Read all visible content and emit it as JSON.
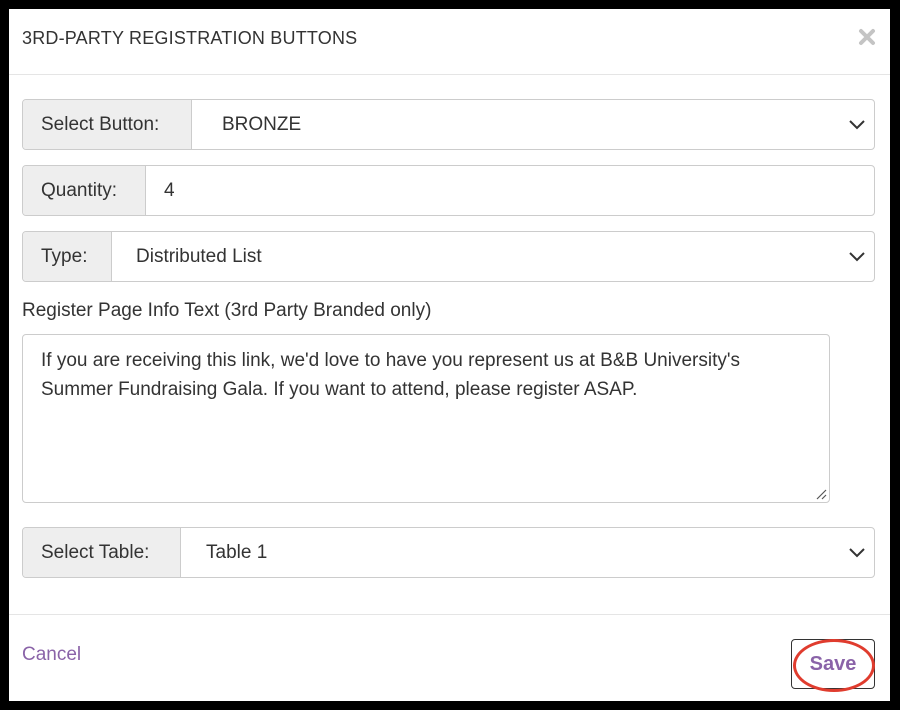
{
  "modal": {
    "title": "3RD-PARTY REGISTRATION BUTTONS",
    "close_icon": "close-icon"
  },
  "fields": {
    "select_button": {
      "label": "Select Button:",
      "value": "BRONZE"
    },
    "quantity": {
      "label": "Quantity:",
      "value": "4"
    },
    "type": {
      "label": "Type:",
      "value": "Distributed List"
    },
    "info_text": {
      "label": "Register Page Info Text (3rd Party Branded only)",
      "value": "If you are receiving this link, we'd love to have you represent us at B&B University's Summer Fundraising Gala. If you want to attend, please register ASAP."
    },
    "select_table": {
      "label": "Select Table:",
      "value": "Table 1"
    }
  },
  "footer": {
    "cancel_label": "Cancel",
    "save_label": "Save"
  },
  "colors": {
    "link_purple": "#8a63a8",
    "highlight_red": "#e03c2e",
    "addon_gray": "#eeeeee"
  }
}
